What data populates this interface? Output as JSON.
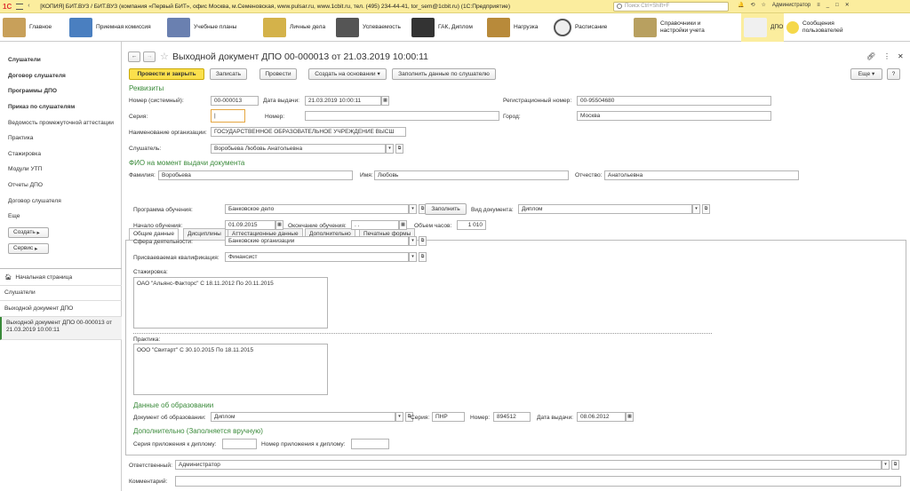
{
  "titlebar": {
    "logo": "1С",
    "title": "[КОПИЯ] БИТ.ВУЗ / БИТ.ВУЗ (компания «Первый БИТ», офис Москва, м.Семеновская, www.pulsar.ru, www.1cbit.ru, тел. (495) 234-44-41, tor_sem@1cbit.ru)  (1С:Предприятие)",
    "search_placeholder": "Поиск Ctrl+Shift+F",
    "user": "Администратор"
  },
  "toolbar": {
    "items": [
      {
        "label": "Главное",
        "icon": "desk-icon"
      },
      {
        "label": "Приемная комиссия",
        "icon": "building-icon"
      },
      {
        "label": "Учебные планы",
        "icon": "keyboard-icon"
      },
      {
        "label": "Личные дела",
        "icon": "folder-icon"
      },
      {
        "label": "Успеваемость",
        "icon": "student-icon"
      },
      {
        "label": "ГАК, Диплом",
        "icon": "graduation-cap-icon"
      },
      {
        "label": "Нагрузка",
        "icon": "scales-icon"
      },
      {
        "label": "Расписание",
        "icon": "clock-icon"
      },
      {
        "label": "Справочники и настройки учета",
        "icon": "books-icon"
      },
      {
        "label": "ДПО",
        "icon": "person-icon"
      },
      {
        "label": "Сообщения пользователей",
        "icon": "message-icon"
      }
    ]
  },
  "sidebar": {
    "items": [
      {
        "label": "Слушатели",
        "bold": true
      },
      {
        "label": "Договор слушателя",
        "bold": true
      },
      {
        "label": "Программы ДПО",
        "bold": true
      },
      {
        "label": "Приказ по слушателям",
        "bold": true
      },
      {
        "label": "Ведомость промежуточной аттестации",
        "bold": false
      },
      {
        "label": "Практика",
        "bold": false
      },
      {
        "label": "Стажировка",
        "bold": false
      },
      {
        "label": "Модули УТП",
        "bold": false
      },
      {
        "label": "Отчеты ДПО",
        "bold": false
      },
      {
        "label": "Договор слушателя",
        "bold": false
      },
      {
        "label": "Еще",
        "bold": false
      }
    ],
    "create_btn": "Создать",
    "service_btn": "Сервис",
    "nav": [
      "Начальная страница",
      "Слушатели",
      "Выходной документ ДПО",
      "Выходной документ ДПО 00-000013 от 21.03.2019 10:00:11"
    ]
  },
  "document": {
    "title": "Выходной документ ДПО 00-000013 от 21.03.2019 10:00:11",
    "buttons": {
      "post_close": "Провести и закрыть",
      "save": "Записать",
      "post": "Провести",
      "create_based": "Создать на основании",
      "fill_data": "Заполнить данные по слушателю",
      "more": "Еще",
      "help": "?"
    },
    "requisites_header": "Реквизиты",
    "fields": {
      "number_label": "Номер (системный):",
      "number": "00-000013",
      "issue_date_label": "Дата выдачи:",
      "issue_date": "21.03.2019 10:00:11",
      "reg_number_label": "Регистрационный номер:",
      "reg_number": "00-95504680",
      "series_label": "Серия:",
      "series": "|",
      "num_label": "Номер:",
      "num": "",
      "city_label": "Город:",
      "city": "Москва",
      "org_label": "Наименование организации:",
      "org": "ГОСУДАРСТВЕННОЕ ОБРАЗОВАТЕЛЬНОЕ УЧРЕЖДЕНИЕ ВЫСШ",
      "listener_label": "Слушатель:",
      "listener": "Воробьева Любовь Анатольевна"
    },
    "fio_header": "ФИО на момент выдачи документа",
    "fio": {
      "surname_label": "Фамилия:",
      "surname": "Воробьева",
      "name_label": "Имя:",
      "name": "Любовь",
      "patronymic_label": "Отчество:",
      "patronymic": "Анатольевна"
    },
    "tabs": [
      "Общие данные",
      "Дисциплины",
      "Аттестационные данные",
      "Дополнительно",
      "Печатные формы"
    ],
    "general": {
      "program_label": "Программа обучения:",
      "program": "Банковское дело",
      "fill_btn": "Заполнить",
      "doc_type_label": "Вид документа:",
      "doc_type": "Диплом",
      "start_label": "Начало обучения:",
      "start": "01.09.2015",
      "end_label": "Окончание обучения:",
      "end": " .  .",
      "hours_label": "Объем часов:",
      "hours": "1 010",
      "sphere_label": "Сфера деятельности:",
      "sphere": "Банковские организации",
      "qual_label": "Присваеваемая квалификация:",
      "qual": "Финансист",
      "internship_label": "Стажировка:",
      "internship": "ОАО \"Альянс-Факторс\" С 18.11.2012 По 20.11.2015",
      "practice_label": "Практика:",
      "practice": "ООО \"Свитарт\" С 30.10.2015 По 18.11.2015"
    },
    "education_header": "Данные об образовании",
    "education": {
      "doc_label": "Документ об образовании:",
      "doc": "Диплом",
      "series_label": "Серия:",
      "series": "ПНР",
      "number_label": "Номер:",
      "number": "894512",
      "date_label": "Дата выдачи:",
      "date": "08.06.2012"
    },
    "additional_header": "Дополнительно  (Заполняется вручную)",
    "additional": {
      "app_series_label": "Серия приложения к диплому:",
      "app_series": "",
      "app_number_label": "Номер приложения к диплому:",
      "app_number": ""
    },
    "responsible_label": "Ответственный:",
    "responsible": "Администратор",
    "comment_label": "Комментарий:",
    "comment": ""
  }
}
